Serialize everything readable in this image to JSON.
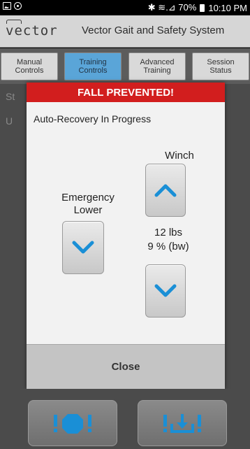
{
  "status_bar": {
    "signal_text": "✱ ≋.⊿ 70%",
    "time": "10:10 PM"
  },
  "app": {
    "logo_text": "vector",
    "title": "Vector Gait and Safety System"
  },
  "tabs": [
    {
      "label": "Manual\nControls",
      "active": false
    },
    {
      "label": "Training\nControls",
      "active": true
    },
    {
      "label": "Advanced\nTraining",
      "active": false
    },
    {
      "label": "Session\nStatus",
      "active": false
    }
  ],
  "background": {
    "line1": "St",
    "line2": "U"
  },
  "dialog": {
    "title": "FALL PREVENTED!",
    "message": "Auto-Recovery In Progress",
    "emergency_label": "Emergency\nLower",
    "winch_label": "Winch",
    "weight": "12 lbs",
    "percent": "9 % (bw)",
    "close_label": "Close"
  },
  "bottom_buttons": [
    {
      "icon": "stop-icon"
    },
    {
      "icon": "lower-icon"
    }
  ],
  "colors": {
    "alert_red": "#d21e1e",
    "accent_blue": "#1a8fd6",
    "active_tab": "#5aa5d8"
  }
}
